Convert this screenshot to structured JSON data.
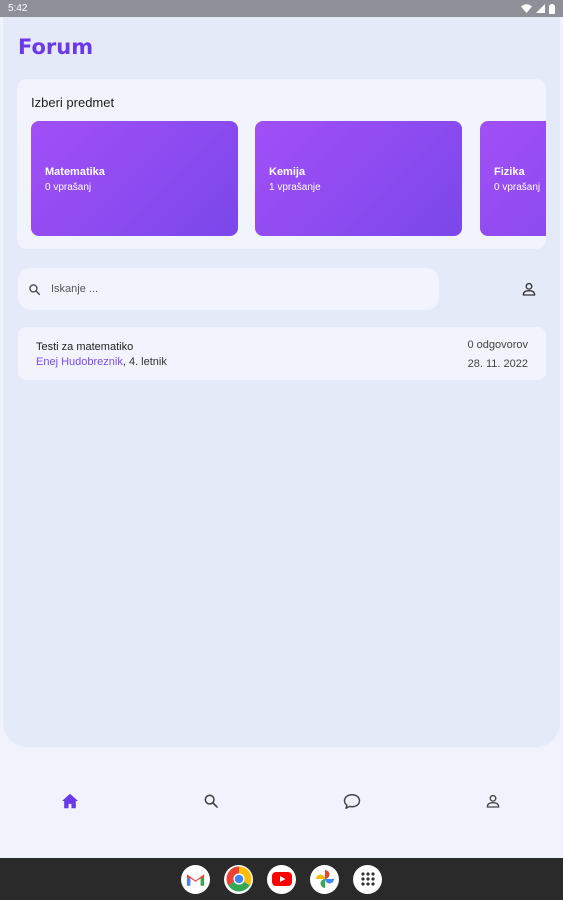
{
  "status_bar": {
    "time": "5:42"
  },
  "page": {
    "title": "Forum"
  },
  "subjects": {
    "heading": "Izberi predmet",
    "items": [
      {
        "name": "Matematika",
        "count": "0 vprašanj"
      },
      {
        "name": "Kemija",
        "count": "1 vprašanje"
      },
      {
        "name": "Fizika",
        "count": "0 vprašanj"
      }
    ]
  },
  "search": {
    "placeholder": "Iskanje ..."
  },
  "posts": [
    {
      "title": "Testi za matematiko",
      "author": "Enej Hudobreznik",
      "year": ", 4. letnik",
      "answers": "0 odgovorov",
      "date": "28. 11. 2022"
    }
  ],
  "colors": {
    "accent": "#6b39e8",
    "tile_gradient_start": "#a24ff7",
    "tile_gradient_end": "#7a48ea",
    "background": "#e5eaf9",
    "nav_active": "#6b39e8",
    "nav_inactive": "#444444"
  },
  "icons": {
    "status": [
      "wifi-icon",
      "signal-icon",
      "battery-icon"
    ],
    "search": "search-icon",
    "profile": "person-icon",
    "nav": [
      "home-icon",
      "search-icon",
      "chat-icon",
      "person-icon"
    ],
    "taskbar": [
      "gmail-icon",
      "chrome-icon",
      "youtube-icon",
      "photos-icon",
      "app-drawer-icon"
    ]
  }
}
